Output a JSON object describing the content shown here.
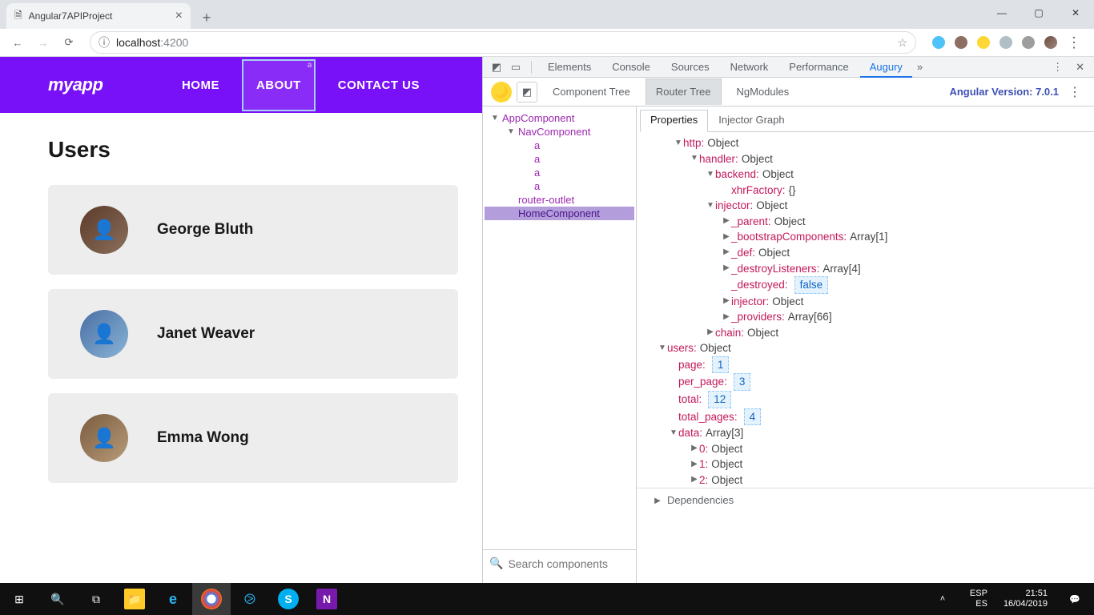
{
  "browser": {
    "tab_title": "Angular7APIProject",
    "url_host": "localhost",
    "url_path": ":4200"
  },
  "app": {
    "logo": "myapp",
    "nav": {
      "home": "HOME",
      "about": "ABOUT",
      "contact": "CONTACT US"
    },
    "page_title": "Users",
    "users": [
      {
        "name": "George Bluth"
      },
      {
        "name": "Janet Weaver"
      },
      {
        "name": "Emma Wong"
      }
    ]
  },
  "devtools": {
    "tabs": {
      "elements": "Elements",
      "console": "Console",
      "sources": "Sources",
      "network": "Network",
      "performance": "Performance",
      "augury": "Augury"
    },
    "augury": {
      "tabs": {
        "component_tree": "Component Tree",
        "router_tree": "Router Tree",
        "ngmodules": "NgModules"
      },
      "version_label": "Angular Version: 7.0.1",
      "search_placeholder": "Search components",
      "tree": {
        "app": "AppComponent",
        "nav": "NavComponent",
        "a": "a",
        "outlet": "router-outlet",
        "home": "HomeComponent"
      },
      "props_tabs": {
        "properties": "Properties",
        "injector": "Injector Graph"
      },
      "props": {
        "http": {
          "k": "http",
          "v": "Object"
        },
        "handler": {
          "k": "handler",
          "v": "Object"
        },
        "backend": {
          "k": "backend",
          "v": "Object"
        },
        "xhrFactory": {
          "k": "xhrFactory",
          "v": "{}"
        },
        "injector_obj": {
          "k": "injector",
          "v": "Object"
        },
        "_parent": {
          "k": "_parent",
          "v": "Object"
        },
        "_bootstrap": {
          "k": "_bootstrapComponents",
          "v": "Array[1]"
        },
        "_def": {
          "k": "_def",
          "v": "Object"
        },
        "_destroyListeners": {
          "k": "_destroyListeners",
          "v": "Array[4]"
        },
        "_destroyed": {
          "k": "_destroyed",
          "v": "false"
        },
        "injector2": {
          "k": "injector",
          "v": "Object"
        },
        "_providers": {
          "k": "_providers",
          "v": "Array[66]"
        },
        "chain": {
          "k": "chain",
          "v": "Object"
        },
        "users": {
          "k": "users",
          "v": "Object"
        },
        "page": {
          "k": "page",
          "v": "1"
        },
        "per_page": {
          "k": "per_page",
          "v": "3"
        },
        "total": {
          "k": "total",
          "v": "12"
        },
        "total_pages": {
          "k": "total_pages",
          "v": "4"
        },
        "data": {
          "k": "data",
          "v": "Array[3]"
        },
        "d0": {
          "k": "0",
          "v": "Object"
        },
        "d1": {
          "k": "1",
          "v": "Object"
        },
        "d2": {
          "k": "2",
          "v": "Object"
        },
        "dependencies": "Dependencies"
      }
    }
  },
  "taskbar": {
    "lang1": "ESP",
    "lang2": "ES",
    "time": "21:51",
    "date": "16/04/2019"
  }
}
